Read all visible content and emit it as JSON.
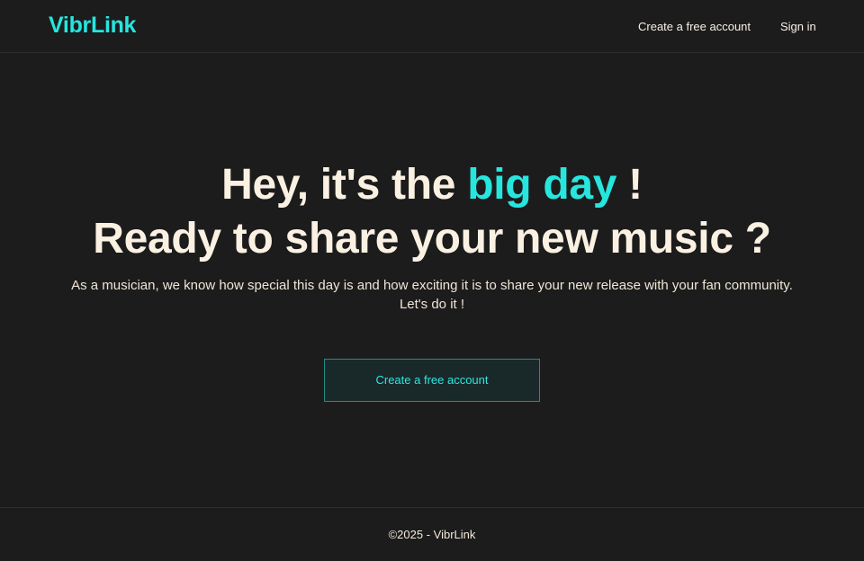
{
  "header": {
    "logo": "VibrLink",
    "nav": {
      "create_account": "Create a free account",
      "sign_in": "Sign in"
    }
  },
  "hero": {
    "line1_prefix": "Hey, it's the ",
    "line1_accent": "big day",
    "line1_suffix": " !",
    "line2": "Ready to share your new music ?",
    "subtitle_line1": "As a musician, we know how special this day is and how exciting it is to share your new release with your fan community.",
    "subtitle_line2": "Let's do it !",
    "cta_label": "Create a free account"
  },
  "footer": {
    "copyright": "©2025 - VibrLink"
  },
  "colors": {
    "background": "#1c1c1d",
    "accent": "#26e6de",
    "text": "#f5ecdd"
  }
}
